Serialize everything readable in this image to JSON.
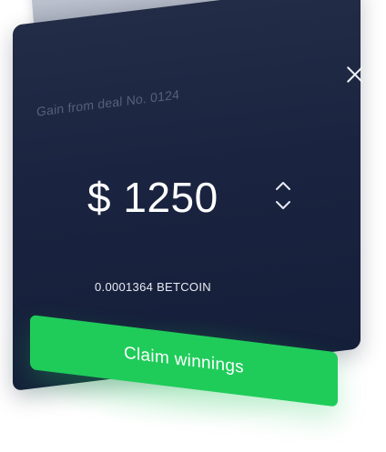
{
  "modal": {
    "deal_label": "Gain from deal No. 0124",
    "amount": "$ 1250",
    "crypto_amount": "0.0001364 BETCOIN",
    "claim_label": "Claim winnings"
  },
  "colors": {
    "card_bg": "#1a2440",
    "accent_green": "#1fcc5a",
    "muted_text": "#55607c"
  },
  "icons": {
    "close": "close-icon",
    "stepper": "chevron-up-down-icon"
  }
}
